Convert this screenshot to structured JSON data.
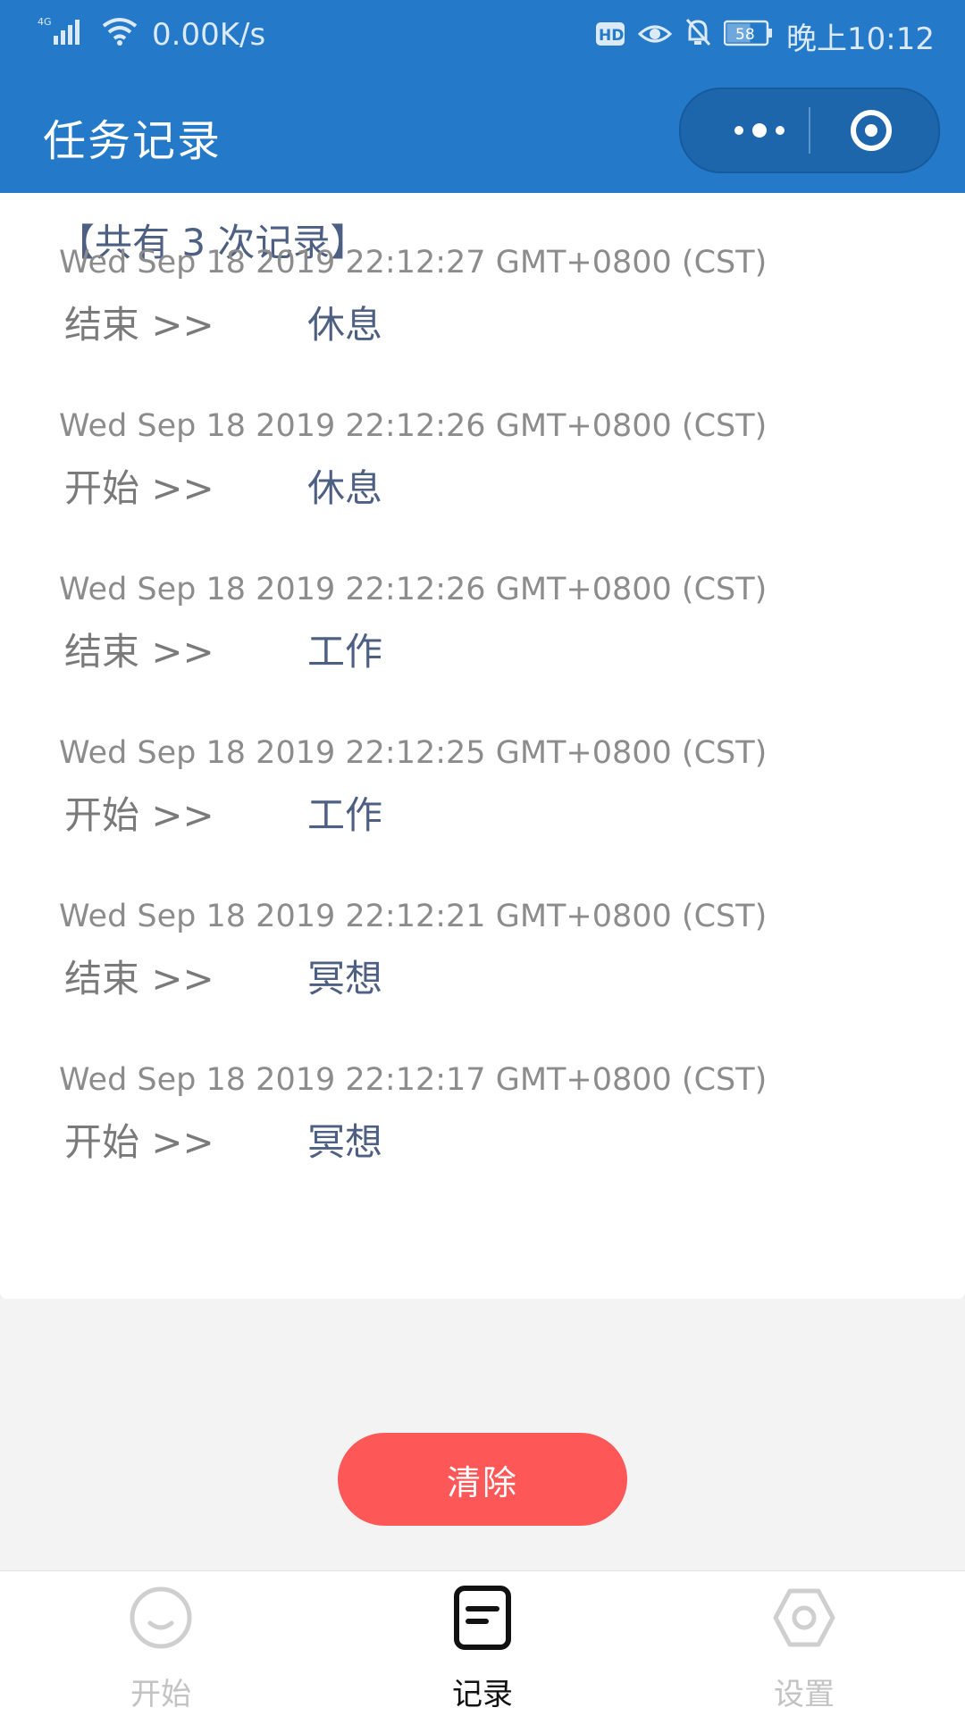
{
  "status_bar": {
    "network": "4G",
    "speed": "0.00K/s",
    "hd_badge": "HD",
    "battery": "58",
    "time": "晚上10:12",
    "icons": [
      "signal-icon",
      "wifi-icon",
      "hd-icon",
      "eye-icon",
      "mute-bell-icon",
      "battery-icon"
    ]
  },
  "nav": {
    "title": "任务记录"
  },
  "summary_text": "【共有 3 次记录】",
  "records": [
    {
      "time": "Wed Sep 18 2019 22:12:27 GMT+0800 (CST)",
      "action": "结束 >>",
      "task": "休息"
    },
    {
      "time": "Wed Sep 18 2019 22:12:26 GMT+0800 (CST)",
      "action": "开始 >>",
      "task": "休息"
    },
    {
      "time": "Wed Sep 18 2019 22:12:26 GMT+0800 (CST)",
      "action": "结束 >>",
      "task": "工作"
    },
    {
      "time": "Wed Sep 18 2019 22:12:25 GMT+0800 (CST)",
      "action": "开始 >>",
      "task": "工作"
    },
    {
      "time": "Wed Sep 18 2019 22:12:21 GMT+0800 (CST)",
      "action": "结束 >>",
      "task": "冥想"
    },
    {
      "time": "Wed Sep 18 2019 22:12:17 GMT+0800 (CST)",
      "action": "开始 >>",
      "task": "冥想"
    }
  ],
  "clear_button": "清除",
  "tabs": [
    {
      "label": "开始",
      "icon": "smile-icon",
      "active": false
    },
    {
      "label": "记录",
      "icon": "record-icon",
      "active": true
    },
    {
      "label": "设置",
      "icon": "hexagon-settings-icon",
      "active": false
    }
  ],
  "colors": {
    "primary": "#2479c8",
    "button_red": "#fd5757",
    "task_text": "#4d5f82"
  }
}
